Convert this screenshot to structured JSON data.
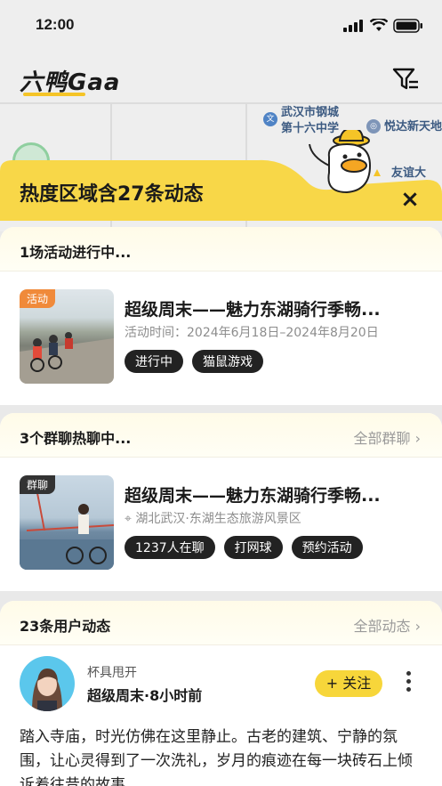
{
  "status_bar": {
    "time": "12:00"
  },
  "header": {
    "logo": "六鸭Gaa"
  },
  "map": {
    "labels": [
      "武汉市钢城",
      "第十六中学",
      "悦达新天地",
      "友谊大"
    ]
  },
  "sheet": {
    "title": "热度区域含27条动态",
    "close": "×"
  },
  "activities": {
    "heading": "1场活动进行中...",
    "item": {
      "badge": "活动",
      "title": "超级周末——魅力东湖骑行季畅...",
      "time": "活动时间：2024年6月18日–2024年8月20日",
      "tags": [
        "进行中",
        "猫鼠游戏"
      ]
    }
  },
  "groups": {
    "heading": "3个群聊热聊中...",
    "link": "全部群聊",
    "item": {
      "badge": "群聊",
      "title": "超级周末——魅力东湖骑行季畅...",
      "location": "湖北武汉·东湖生态旅游风景区",
      "tags": [
        "1237人在聊",
        "打网球",
        "预约活动"
      ]
    }
  },
  "feed": {
    "heading": "23条用户动态",
    "link": "全部动态",
    "post": {
      "username": "杯具甩开",
      "meta": "超级周末·8小时前",
      "follow": "+ 关注",
      "text": "踏入寺庙，时光仿佛在这里静止。古老的建筑、宁静的氛围，让心灵得到了一次洗礼，岁月的痕迹在每一块砖石上倾诉着往昔的故事。"
    }
  },
  "colors": {
    "accent": "#f7d63a",
    "badge_activity": "#f08a3a",
    "badge_group": "#333333"
  }
}
